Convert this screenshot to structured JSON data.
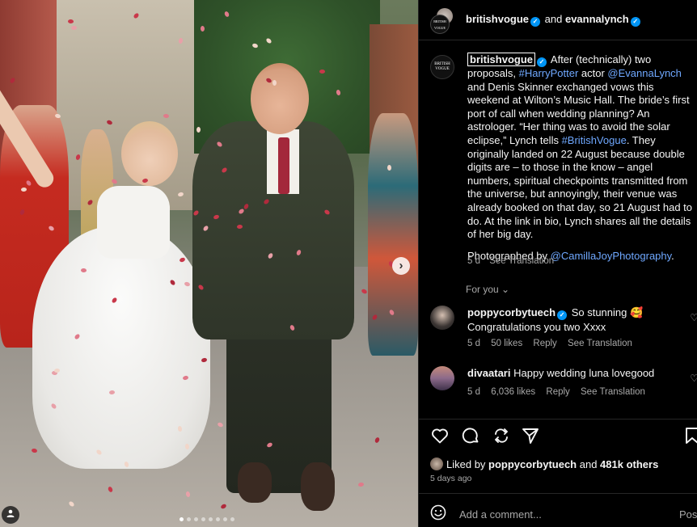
{
  "header": {
    "user1": "britishvogue",
    "and": "and",
    "user2": "evannalynch"
  },
  "caption": {
    "username": "britishvogue",
    "text1": " After (technically) two proposals, ",
    "tag1": "#HarryPotter",
    "text2": " actor ",
    "mention1": "@EvannaLynch",
    "text3": " and Denis Skinner exchanged vows this weekend at Wilton’s Music Hall. The bride’s first port of call when wedding planning? An astrologer. “Her thing was to avoid the solar eclipse,” Lynch tells ",
    "tag2": "#BritishVogue",
    "text4": ". They originally landed on 22 August because double digits are – to those in the know – angel numbers, spiritual checkpoints transmitted from the universe, but annoyingly, their venue was already booked on that day, so 21 August had to do. At the link in bio, Lynch shares all the details of her big day.",
    "photo_prefix": "Photographed by ",
    "photo_mention": "@CamillaJoyPhotography",
    "photo_suffix": ".",
    "age": "5 d",
    "translate": "See Translation"
  },
  "vogue_avatar_text": "BRITISH VOGUE",
  "for_you": "For you",
  "comments": [
    {
      "user": "poppycorbytuech",
      "text_line1": " So stunning 🥰",
      "text_line2": "Congratulations you two Xxxx",
      "age": "5 d",
      "likes": "50 likes",
      "reply": "Reply",
      "translate": "See Translation"
    },
    {
      "user": "divaatari",
      "text": " Happy wedding luna lovegood",
      "age": "5 d",
      "likes": "6,036 likes",
      "reply": "Reply",
      "translate": "See Translation"
    }
  ],
  "likes": {
    "prefix": "Liked by ",
    "user": "poppycorbytuech",
    "middle": " and ",
    "count": "481k others"
  },
  "time_ago": "5 days ago",
  "add_comment": {
    "placeholder": "Add a comment...",
    "post": "Post"
  },
  "colors": {
    "link": "#6fa8ff",
    "verified": "#0095f6",
    "muted": "#a8a8a8",
    "background": "#000000"
  },
  "icons": [
    "heart-icon",
    "comment-icon",
    "share-icon",
    "send-icon",
    "bookmark-icon",
    "emoji-icon",
    "next-arrow-icon",
    "tag-user-icon"
  ]
}
